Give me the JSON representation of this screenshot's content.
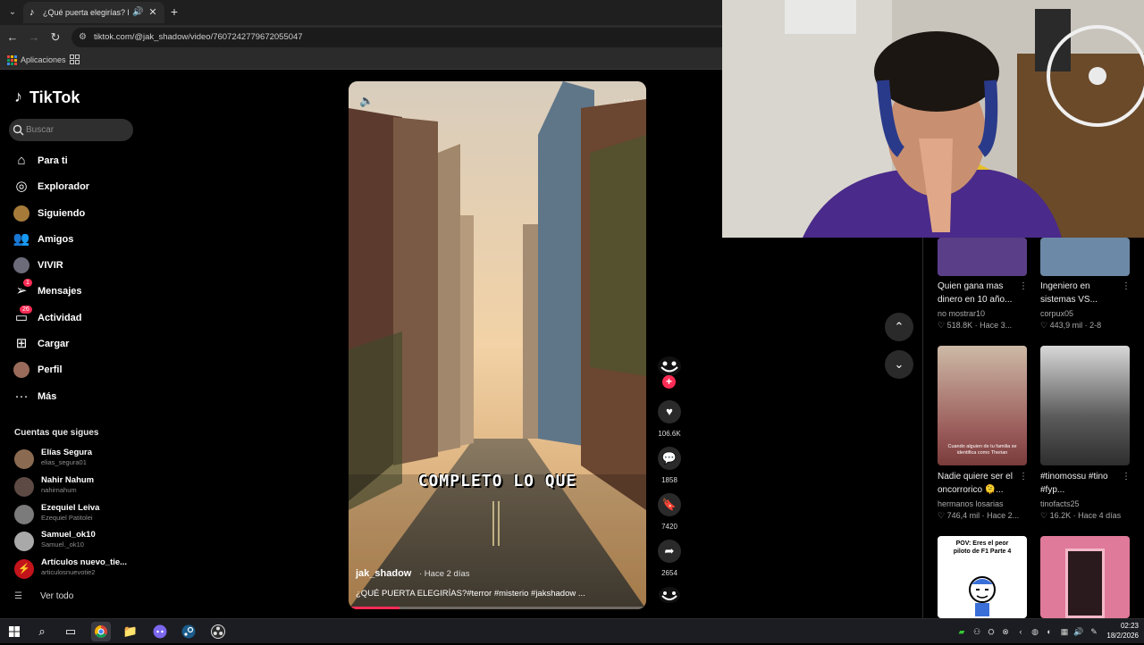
{
  "browser": {
    "tab_title": "¿Qué puerta elegirías? Desc",
    "url": "tiktok.com/@jak_shadow/video/7607242779672055047",
    "bookmark_apps": "Aplicaciones"
  },
  "tiktok": {
    "logo": "TikTok",
    "search_placeholder": "Buscar",
    "nav": [
      {
        "label": "Para ti",
        "icon": "home-icon"
      },
      {
        "label": "Explorador",
        "icon": "compass-icon"
      },
      {
        "label": "Siguiendo",
        "icon": "following-avatar"
      },
      {
        "label": "Amigos",
        "icon": "friends-icon"
      },
      {
        "label": "VIVIR",
        "icon": "live-icon"
      },
      {
        "label": "Mensajes",
        "icon": "messages-icon",
        "badge": "1"
      },
      {
        "label": "Actividad",
        "icon": "activity-icon",
        "badge": "26"
      },
      {
        "label": "Cargar",
        "icon": "upload-icon"
      },
      {
        "label": "Perfil",
        "icon": "profile-avatar"
      },
      {
        "label": "Más",
        "icon": "more-icon"
      }
    ],
    "following_header": "Cuentas que sigues",
    "accounts": [
      {
        "name": "Elías Segura",
        "user": "elias_segura01",
        "color": "#8a6b52"
      },
      {
        "name": "Nahir Nahum",
        "user": "nahirnahum",
        "color": "#5d4a44"
      },
      {
        "name": "Ezequiel Leiva",
        "user": "Ezequiel Patitolei",
        "color": "#7b7b7b"
      },
      {
        "name": "Samuel_ok10",
        "user": "Samuel._ok10",
        "color": "#a9a9a9"
      },
      {
        "name": "Artículos nuevo_tie...",
        "user": "articulosnuevotie2",
        "color": "#c4141b"
      }
    ],
    "see_all": "Ver todo"
  },
  "video": {
    "caption": "COMPLETO LO QUE",
    "author": "jak_shadow",
    "time": "· Hace 2 días",
    "description": "¿QUÉ PUERTA ELEGIRÍAS?#terror #misterio #jakshadow ...",
    "progress": 0.17,
    "likes": "106.6K",
    "comments": "1858",
    "saves": "7420",
    "shares": "2654"
  },
  "recommended": [
    {
      "title": "Quien gana mas dinero en 10 año...",
      "author": "no mostrar10",
      "meta": "♡ 518.8K · Hace 3...",
      "thumb": "#5a3f88"
    },
    {
      "title": "Ingeniero en sistemas VS...",
      "author": "corpux05",
      "meta": "♡ 443,9 mil · 2-8",
      "thumb": "#6c8aa7"
    },
    {
      "title": "Nadie quiere ser el oncorrorico 🫠...",
      "author": "hermanos losarias",
      "meta": "♡ 746,4 mil · Hace 2...",
      "thumb": "#9b5d5b",
      "overlay": "Cuando alguien de tu familia se identifica como Therian"
    },
    {
      "title": "#tinomossu #tino #fyp...",
      "author": "tinofacts25",
      "meta": "♡ 16.2K · Hace 4 días",
      "thumb": "#4c4c4c"
    },
    {
      "title": "",
      "author": "",
      "meta": "",
      "thumb": "#ffffff",
      "overlay": "POV: Eres el peor piloto de F1 Parte 4"
    },
    {
      "title": "",
      "author": "",
      "meta": "",
      "thumb": "#e07a9a"
    }
  ],
  "taskbar": {
    "time": "02:23",
    "date": "18/2/2026"
  }
}
